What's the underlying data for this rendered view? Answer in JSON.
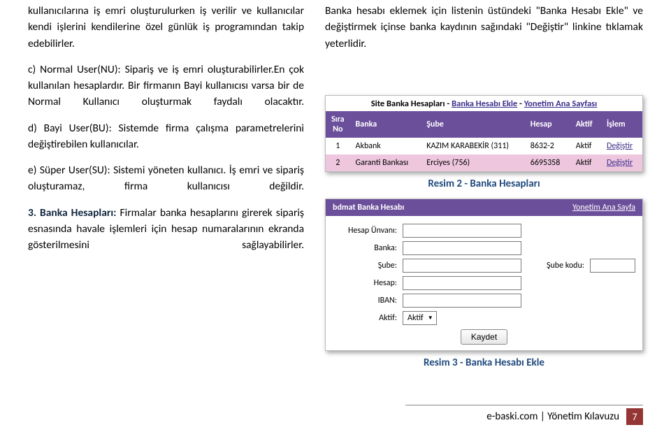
{
  "left": {
    "p1": "kullanıcılarına iş emri oluşturulurken iş verilir ve kullanıcılar kendi işlerini kendilerine özel günlük iş programından takip edebilirler.",
    "p2": "c) Normal User(NU): Sipariş ve iş emri oluşturabilirler.En çok kullanılan hesaplardır. Bir firmanın Bayi kullanıcısı varsa bir de Normal Kullanıcı oluşturmak faydalı olacaktır.",
    "p3": "d) Bayi User(BU): Sistemde firma çalışma parametrelerini değiştirebilen kullanıcılar.",
    "p4": "e) Süper User(SU): Sistemi yöneten kullanıcı. İş emri ve sipariş oluşturamaz, firma kullanıcısı değildir.",
    "section": "3. Banka Hesapları:",
    "p5": "Firmalar banka hesaplarını girerek sipariş esnasında havale işlemleri için hesap numaralarının ekranda gösterilmesini sağlayabilirler."
  },
  "right": {
    "intro": "Banka hesabı eklemek için listenin üstündeki \"Banka Hesabı Ekle\" ve değiştirmek içinse banka kaydının sağındaki \"Değiştir\" linkine tıklamak yeterlidir.",
    "caption1": "Resim 2 - Banka Hesapları",
    "caption2": "Resim 3 - Banka Hesabı Ekle"
  },
  "shot1": {
    "title_prefix": "Site Banka Hesapları",
    "sep": " - ",
    "link1": "Banka Hesabı Ekle",
    "link2": "Yonetim Ana Sayfası",
    "headers": {
      "no": "Sıra No",
      "banka": "Banka",
      "sube": "Şube",
      "hesap": "Hesap",
      "aktif": "Aktif",
      "islem": "İşlem"
    },
    "rows": [
      {
        "no": "1",
        "banka": "Akbank",
        "sube": "KAZIM KARABEKİR (311)",
        "hesap": "8632-2",
        "aktif": "Aktif",
        "islem": "Değiştir"
      },
      {
        "no": "2",
        "banka": "Garanti Bankası",
        "sube": "Erciyes (756)",
        "hesap": "6695358",
        "aktif": "Aktif",
        "islem": "Değiştir"
      }
    ]
  },
  "shot2": {
    "title": "bdmat Banka Hesabı",
    "yon": "Yonetim Ana Sayfa",
    "labels": {
      "unvan": "Hesap Ünvanı:",
      "banka": "Banka:",
      "sube": "Şube:",
      "subekodu": "Şube kodu:",
      "hesap": "Hesap:",
      "iban": "IBAN:",
      "aktif": "Aktif:"
    },
    "aktif_val": "Aktif",
    "kaydet": "Kaydet"
  },
  "footer": {
    "text": "e-baski.com | Yönetim Kılavuzu",
    "page": "7"
  }
}
